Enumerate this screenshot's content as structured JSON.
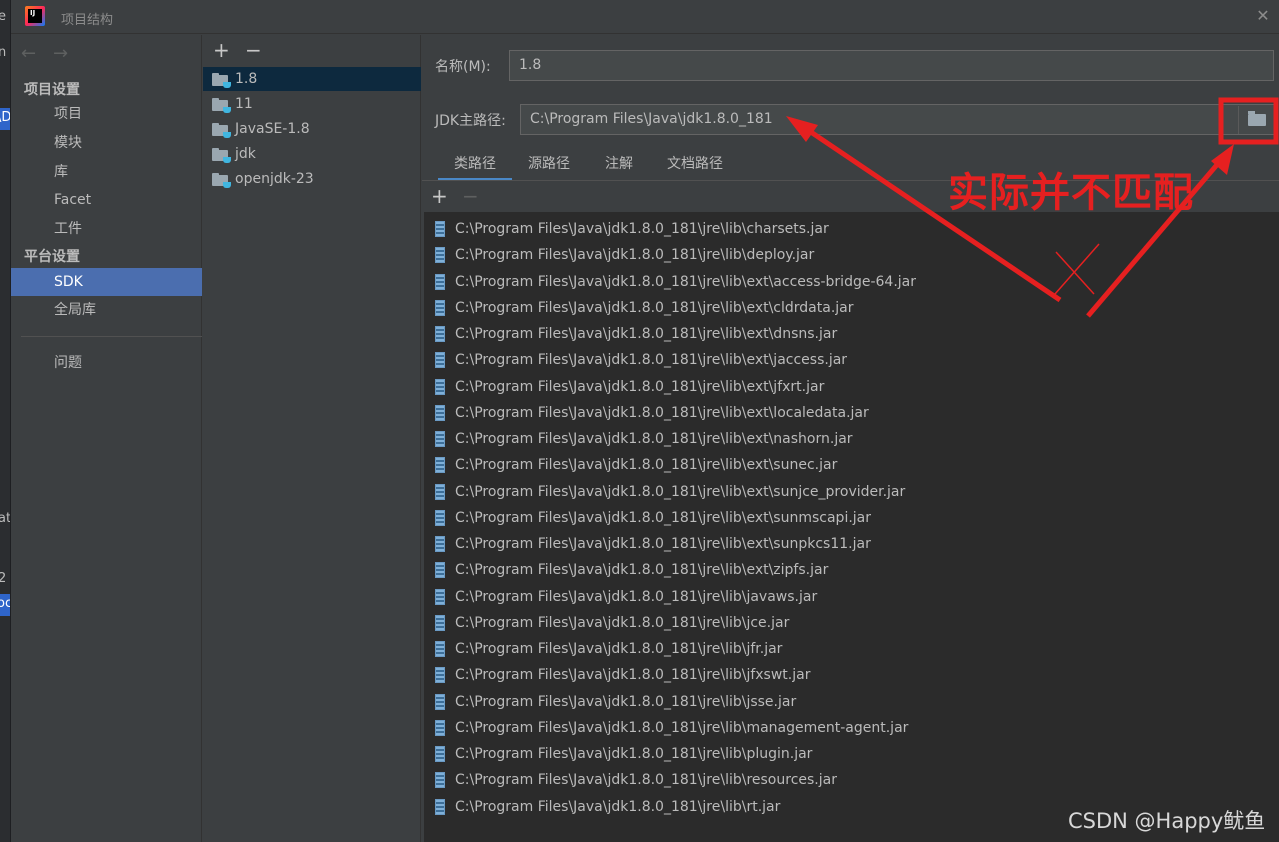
{
  "window": {
    "title": "项目结构"
  },
  "edge": {
    "t1": "e",
    "t2": "n",
    "t3": "\\D",
    "t4": "ati",
    "t5": "2",
    "t6": "oc"
  },
  "nav": {
    "back_icon": "arrow-left-icon",
    "forward_icon": "arrow-right-icon",
    "project_settings_header": "项目设置",
    "project_settings": [
      "项目",
      "模块",
      "库",
      "Facet",
      "工件"
    ],
    "platform_settings_header": "平台设置",
    "platform_settings": [
      "SDK",
      "全局库"
    ],
    "selected": "SDK",
    "problems": "问题"
  },
  "sdk_list": {
    "add_label": "+",
    "remove_label": "−",
    "items": [
      "1.8",
      "11",
      "JavaSE-1.8",
      "jdk",
      "openjdk-23"
    ],
    "selected": "1.8"
  },
  "detail": {
    "name_label": "名称(M):",
    "name_value": "1.8",
    "home_label": "JDK主路径:",
    "home_value": "C:\\Program Files\\Java\\jdk1.8.0_181",
    "tabs": [
      "类路径",
      "源路径",
      "注解",
      "文档路径"
    ],
    "active_tab": "类路径",
    "paths_add": "+",
    "paths_remove": "−",
    "class_paths": [
      "C:\\Program Files\\Java\\jdk1.8.0_181\\jre\\lib\\charsets.jar",
      "C:\\Program Files\\Java\\jdk1.8.0_181\\jre\\lib\\deploy.jar",
      "C:\\Program Files\\Java\\jdk1.8.0_181\\jre\\lib\\ext\\access-bridge-64.jar",
      "C:\\Program Files\\Java\\jdk1.8.0_181\\jre\\lib\\ext\\cldrdata.jar",
      "C:\\Program Files\\Java\\jdk1.8.0_181\\jre\\lib\\ext\\dnsns.jar",
      "C:\\Program Files\\Java\\jdk1.8.0_181\\jre\\lib\\ext\\jaccess.jar",
      "C:\\Program Files\\Java\\jdk1.8.0_181\\jre\\lib\\ext\\jfxrt.jar",
      "C:\\Program Files\\Java\\jdk1.8.0_181\\jre\\lib\\ext\\localedata.jar",
      "C:\\Program Files\\Java\\jdk1.8.0_181\\jre\\lib\\ext\\nashorn.jar",
      "C:\\Program Files\\Java\\jdk1.8.0_181\\jre\\lib\\ext\\sunec.jar",
      "C:\\Program Files\\Java\\jdk1.8.0_181\\jre\\lib\\ext\\sunjce_provider.jar",
      "C:\\Program Files\\Java\\jdk1.8.0_181\\jre\\lib\\ext\\sunmscapi.jar",
      "C:\\Program Files\\Java\\jdk1.8.0_181\\jre\\lib\\ext\\sunpkcs11.jar",
      "C:\\Program Files\\Java\\jdk1.8.0_181\\jre\\lib\\ext\\zipfs.jar",
      "C:\\Program Files\\Java\\jdk1.8.0_181\\jre\\lib\\javaws.jar",
      "C:\\Program Files\\Java\\jdk1.8.0_181\\jre\\lib\\jce.jar",
      "C:\\Program Files\\Java\\jdk1.8.0_181\\jre\\lib\\jfr.jar",
      "C:\\Program Files\\Java\\jdk1.8.0_181\\jre\\lib\\jfxswt.jar",
      "C:\\Program Files\\Java\\jdk1.8.0_181\\jre\\lib\\jsse.jar",
      "C:\\Program Files\\Java\\jdk1.8.0_181\\jre\\lib\\management-agent.jar",
      "C:\\Program Files\\Java\\jdk1.8.0_181\\jre\\lib\\plugin.jar",
      "C:\\Program Files\\Java\\jdk1.8.0_181\\jre\\lib\\resources.jar",
      "C:\\Program Files\\Java\\jdk1.8.0_181\\jre\\lib\\rt.jar"
    ]
  },
  "annotation": {
    "text": "实际并不匹配",
    "color": "#e62020"
  },
  "watermark": "CSDN @Happy鱿鱼",
  "colors": {
    "background": "#3c3f41",
    "list_background": "#2b2b2b",
    "selection": "#4b6eaf",
    "tab_underline": "#4a88c7"
  }
}
